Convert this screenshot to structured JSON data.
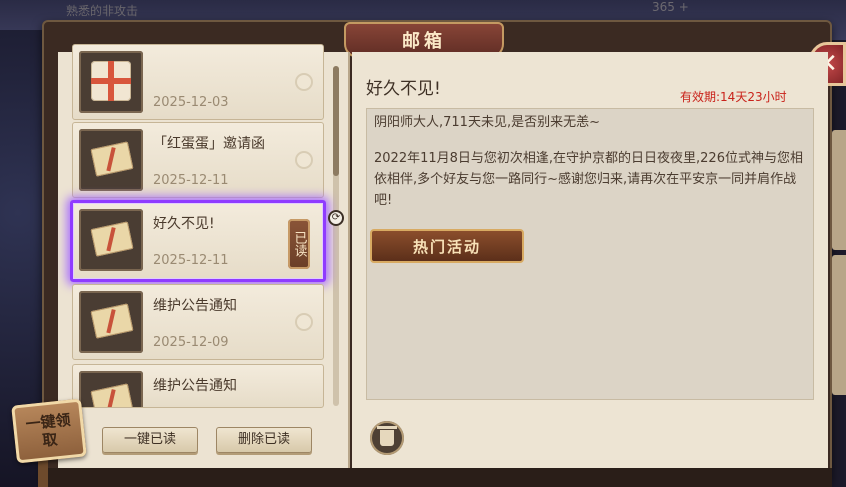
{
  "window": {
    "title": "邮箱",
    "header_faded_text": "熟悉的非攻击",
    "header_faded_number": "365 +"
  },
  "mail_list": [
    {
      "title": "",
      "date": "2025-12-03",
      "icon": "gift-box",
      "selected": false,
      "read": false
    },
    {
      "title": "「红蛋蛋」邀请函",
      "date": "2025-12-11",
      "icon": "envelope",
      "selected": false,
      "read": false
    },
    {
      "title": "好久不见!",
      "date": "2025-12-11",
      "icon": "envelope",
      "selected": true,
      "read": true
    },
    {
      "title": "维护公告通知",
      "date": "2025-12-09",
      "icon": "envelope",
      "selected": false,
      "read": false
    },
    {
      "title": "维护公告通知",
      "date": "",
      "icon": "envelope",
      "selected": false,
      "read": false
    }
  ],
  "read_tag": "已读",
  "actions": {
    "read_all": "一键已读",
    "delete_read": "删除已读",
    "claim_all": "一键领取"
  },
  "detail": {
    "title": "好久不见!",
    "validity_label": "有效期:",
    "validity_value": "14天23小时",
    "greeting": "阴阳师大人,711天未见,是否别来无恙~",
    "body": "2022年11月8日与您初次相逢,在守护京都的日日夜夜里,226位式神与您相依相伴,多个好友与您一路同行~感谢您归来,请再次在平安京一同并肩作战吧!",
    "button_label": "热门活动"
  },
  "icons": {
    "close": "close-icon",
    "delete": "trash-icon",
    "link": "link-icon"
  },
  "colors": {
    "selected_border": "#8f3bff",
    "validity": "#c9221a",
    "title_plate": "#8a4638"
  }
}
